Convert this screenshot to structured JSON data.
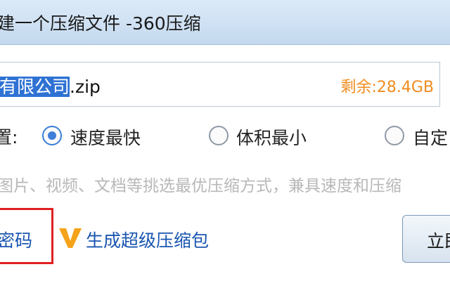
{
  "window": {
    "title": "建一个压缩文件 -360压缩"
  },
  "file": {
    "name_selected": "有限公司",
    "name_suffix": ".zip",
    "space_remaining": "剩余:28.4GB"
  },
  "compress_option": {
    "label": "置:",
    "options": [
      {
        "label": "速度最快",
        "checked": true
      },
      {
        "label": "体积最小",
        "checked": false
      },
      {
        "label": "自定",
        "checked": false
      }
    ],
    "hint": "图片、视频、文档等挑选最优压缩方式，兼具速度和压缩"
  },
  "links": {
    "password": "密码",
    "super_compress": "生成超级压缩包"
  },
  "buttons": {
    "start": "立即"
  },
  "colors": {
    "accent_blue": "#3d7fd9",
    "link_blue": "#1a56b0",
    "space_orange": "#f08c1e",
    "highlight_red": "#e02020",
    "v_icon_orange": "#f5a31a"
  },
  "icons": {
    "super_compress": "v-badge-icon"
  }
}
